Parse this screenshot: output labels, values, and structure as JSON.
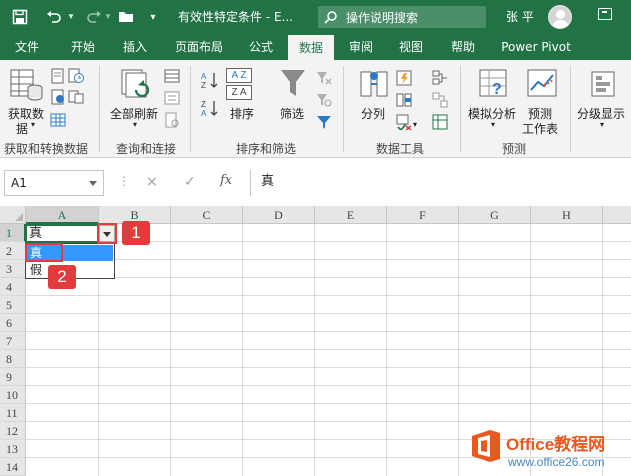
{
  "titlebar": {
    "doc_title": "有效性特定条件 - E...",
    "search_label": "操作说明搜索",
    "user_name": "张 平"
  },
  "ribbon_tabs": [
    {
      "label": "文件"
    },
    {
      "label": "开始"
    },
    {
      "label": "插入"
    },
    {
      "label": "页面布局"
    },
    {
      "label": "公式"
    },
    {
      "label": "数据",
      "active": true
    },
    {
      "label": "审阅"
    },
    {
      "label": "视图"
    },
    {
      "label": "帮助"
    },
    {
      "label": "Power Pivot"
    }
  ],
  "ribbon": {
    "get_data": "获取数",
    "get_data2": "据",
    "group_get_transform": "获取和转换数据",
    "refresh_all": "全部刷新",
    "group_queries": "查询和连接",
    "sort": "排序",
    "filter": "筛选",
    "group_sort_filter": "排序和筛选",
    "text_to_columns": "分列",
    "group_data_tools": "数据工具",
    "what_if": "模拟分析",
    "forecast_sheet": "预测",
    "forecast_sheet2": "工作表",
    "group_forecast": "预测",
    "outline": "分级显示",
    "sort_az_top": "A Z",
    "sort_za_top": "Z A"
  },
  "formula_bar": {
    "name_box": "A1",
    "cancel": "×",
    "enter": "✓",
    "fx": "fx",
    "content": "真"
  },
  "columns": [
    "A",
    "B",
    "C",
    "D",
    "E",
    "F",
    "G",
    "H"
  ],
  "rows": [
    "1",
    "2",
    "3",
    "4",
    "5",
    "6",
    "7",
    "8",
    "9",
    "10",
    "11",
    "12",
    "13",
    "14"
  ],
  "active_cell": {
    "ref": "A1",
    "value": "真"
  },
  "dropdown": {
    "options": [
      "真",
      "假"
    ],
    "highlighted": 0
  },
  "callouts": [
    "1",
    "2"
  ],
  "watermark": {
    "brand": "Office教程网",
    "url": "www.office26.com"
  },
  "colors": {
    "excel_green": "#217346",
    "callout_red": "#e23b3b",
    "highlight_blue": "#3399ff"
  }
}
